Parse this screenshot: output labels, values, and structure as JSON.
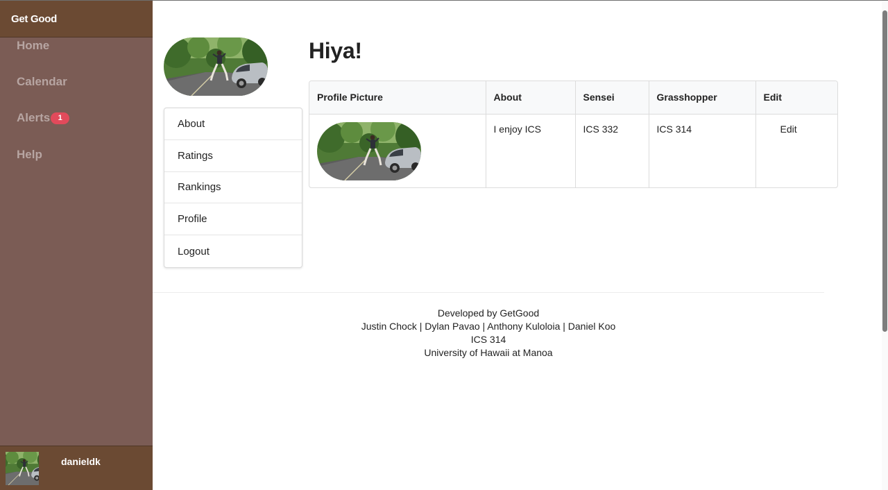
{
  "sidebar": {
    "brand": "Get Good",
    "nav": [
      {
        "label": "Home"
      },
      {
        "label": "Calendar"
      },
      {
        "label": "Alerts",
        "badge": "1"
      },
      {
        "label": "Help"
      }
    ],
    "user": {
      "name": "danieldk",
      "avatar_icon": "user-avatar-photo"
    }
  },
  "profile_menu": {
    "items": [
      {
        "label": "About"
      },
      {
        "label": "Ratings"
      },
      {
        "label": "Rankings"
      },
      {
        "label": "Profile"
      },
      {
        "label": "Logout"
      }
    ]
  },
  "main": {
    "title": "Hiya!",
    "table": {
      "headers": [
        "Profile Picture",
        "About",
        "Sensei",
        "Grasshopper",
        "Edit"
      ],
      "rows": [
        {
          "about": "I enjoy ICS",
          "sensei": "ICS 332",
          "grasshopper": "ICS 314",
          "edit": "Edit"
        }
      ]
    }
  },
  "footer": {
    "lines": [
      "Developed by GetGood",
      "Justin Chock | Dylan Pavao | Anthony Kuloloia | Daniel Koo",
      "ICS 314",
      "University of Hawaii at Manoa"
    ]
  },
  "colors": {
    "sidebar_bg": "#7b5c55",
    "brand_bar_bg": "#6b4a33",
    "badge": "#e24a5b"
  }
}
